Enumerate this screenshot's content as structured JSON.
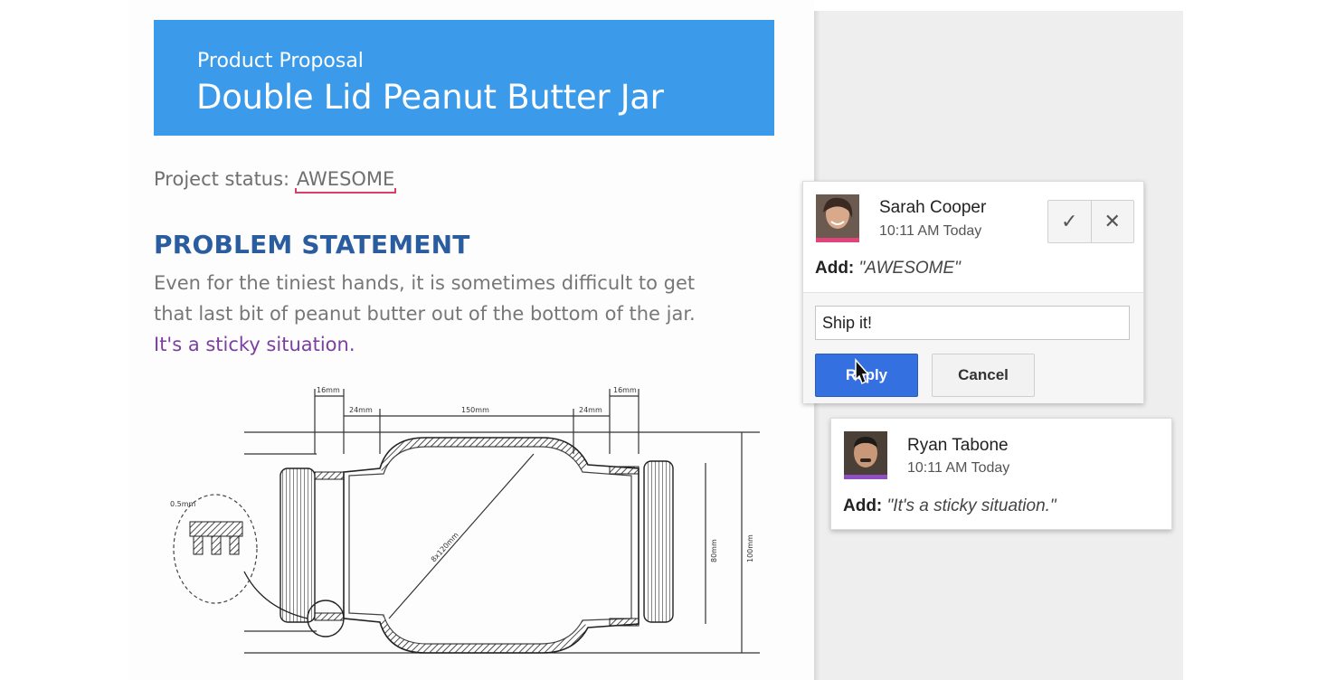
{
  "document": {
    "subtitle": "Product Proposal",
    "title": "Double Lid Peanut Butter Jar",
    "status_label": "Project status: ",
    "status_value": "AWESOME",
    "section_heading": "PROBLEM STATEMENT",
    "paragraph_lines": [
      "Even for the tiniest hands, it is sometimes difficult to get",
      "that last bit of peanut butter out of the bottom of the jar."
    ],
    "highlighted_sentence": "It's a sticky situation.",
    "sketch_labels": [
      "16mm",
      "24mm",
      "150mm",
      "24mm",
      "16mm",
      "8x120mm",
      "80mm",
      "100mm",
      "0.5mm"
    ]
  },
  "comments": [
    {
      "author": "Sarah Cooper",
      "time": "10:11 AM Today",
      "action": "Add:",
      "suggestion": "\"AWESOME\"",
      "avatar_color": "#e0447a",
      "accept_icon": "check-icon",
      "reject_icon": "close-icon"
    },
    {
      "author": "Ryan Tabone",
      "time": "10:11 AM Today",
      "action": "Add:",
      "suggestion": "\"It's a sticky situation.\"",
      "avatar_color": "#8f4fc3"
    }
  ],
  "reply": {
    "input_value": "Ship it!",
    "reply_label": "Reply",
    "cancel_label": "Cancel"
  },
  "colors": {
    "banner": "#3b9bea",
    "heading": "#2a5d9f",
    "highlight_text": "#7b3fa0",
    "reply_button": "#3570e0"
  }
}
